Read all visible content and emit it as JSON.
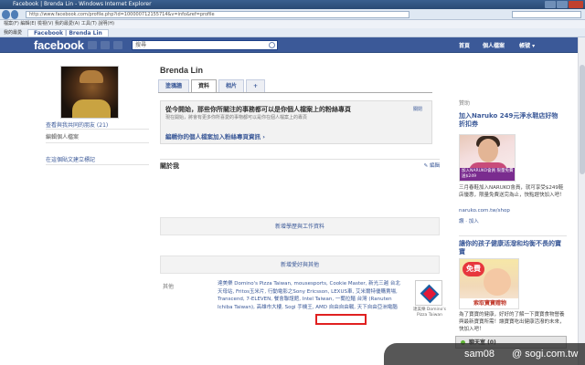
{
  "browser": {
    "title": "Facebook | Brenda Lin - Windows Internet Explorer",
    "url": "http://www.facebook.com/profile.php?id=100000712155714&v=info&ref=profile",
    "menu": "檔案(F)  編輯(E)  檢視(V)  我的最愛(A)  工具(T)  說明(H)",
    "fav_label": "我的最愛",
    "tab_label": "Facebook | Brenda Lin"
  },
  "fb": {
    "logo": "facebook",
    "search_placeholder": "搜尋",
    "nav": [
      "首頁",
      "個人檔案",
      "帳號 ▾"
    ],
    "color_brand": "#3b5998"
  },
  "left": {
    "links": [
      "查看與我共同的朋友 (21)",
      "編輯個人檔案",
      "在這個貼文建立標記"
    ]
  },
  "profile": {
    "name": "Brenda Lin",
    "tabs": [
      "塗鴉牆",
      "資料",
      "相片",
      "+"
    ],
    "active_tab": "資料"
  },
  "notice": {
    "title": "從今開始，那些你所關注的事務都可以是你個人檔案上的粉絲專頁",
    "desc": "現在開始，將會有更多你所喜愛的事物都可以是你在個人檔案上的專頁",
    "close": "關閉",
    "link": "編輯你的個人檔案加入粉絲專頁資訊 ›"
  },
  "about": {
    "title": "關於我",
    "edit": "✎ 編輯",
    "education": "新增學歷與工作資料",
    "likes": "新增愛好與其他",
    "other_label": "其他",
    "other_text": "達美樂 Domino's Pizza Taiwan, mousesports, Cookie Master, 新光三越 台北天母站, Fritos玉米片, 行動電影之Sony Ericsson, LEXUS車, 艾米爾特優購賣場, Transcend, 7-ELEVEN, 餐會聯誼館, Intel Taiwan, 一蘭拉麵 台灣 (Ranuten Ichiba Taiwan), 高雄市大樓, Sogi 手機王, AMD 自由自由戰, 天下自由亞洲電腦",
    "dominos_caption": "達美樂 Domino's Pizza Taiwan"
  },
  "ads": {
    "header": "贊助",
    "ad1_title": "加入Naruko 249元淨水鞋店好物折扣券",
    "ad1_caption": "加入NARUKO會員 限量免費送$249",
    "ad1_text": "三月春鞋加入NARUKO會員，就可享受$249鞋店優惠，限量免費送完為止，快點趕快加入吧！",
    "ad1_link": "naruko.com.tw/shop",
    "like": "讚 · 加入",
    "ad2_title": "讓你的孩子健康活潑和均衡不長的寶寶",
    "ad2_badge": "免費",
    "ad2_caption": "索取寶寶贈物",
    "ad2_text": "為了寶寶的健康，好好的了解一下寶寶食物營養與最新寶寶所需！讓寶寶吃出健康活潑的未來，快加入吧！"
  },
  "chat": {
    "label": "聊天室 (0)"
  },
  "watermark": {
    "user": "sam08",
    "site": "@ sogi.com.tw"
  }
}
